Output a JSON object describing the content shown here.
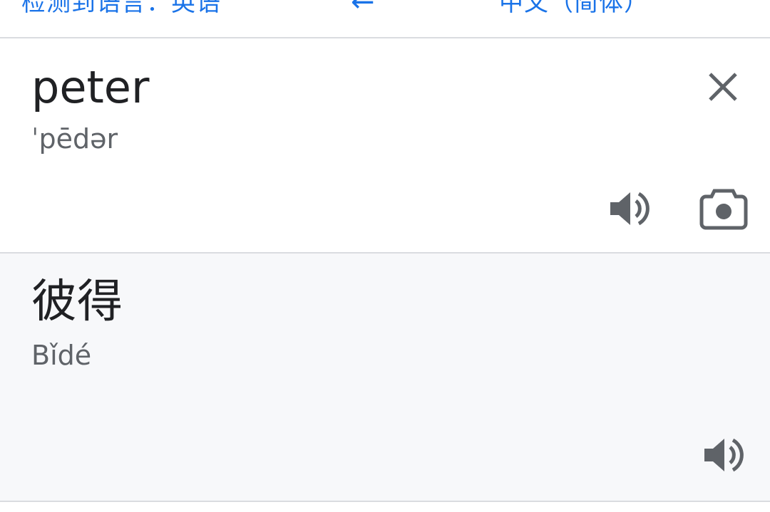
{
  "language_bar": {
    "source_language": "检测到语言：英语",
    "swap_icon": "swap-arrows-icon",
    "target_language": "中文（简体）",
    "accent_color": "#1a73e8"
  },
  "source": {
    "text": "peter",
    "phonetic": "ˈpēdər",
    "close_icon": "close-icon",
    "speak_icon": "speaker-icon",
    "camera_icon": "camera-icon"
  },
  "result": {
    "text": "彼得",
    "pinyin": "Bǐdé",
    "speak_icon": "speaker-icon",
    "background_color": "#f7f8fa"
  }
}
